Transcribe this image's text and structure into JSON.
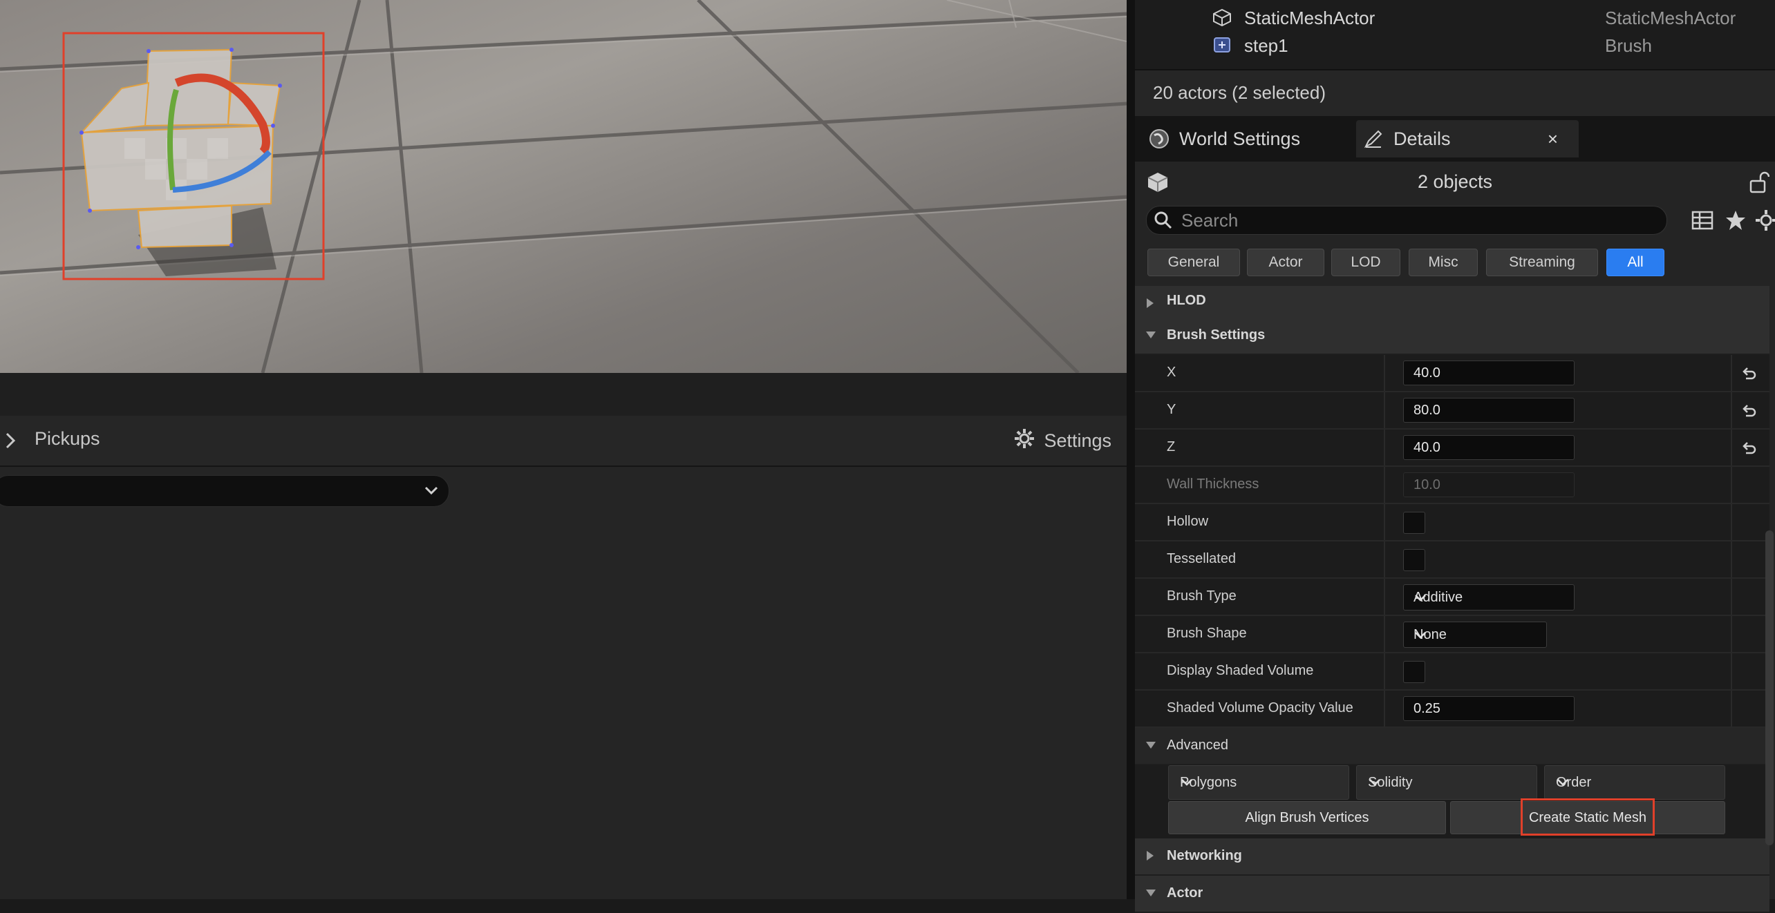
{
  "outliner": {
    "rows": [
      {
        "name": "StaticMeshActor",
        "type": "StaticMeshActor",
        "icon": "static-mesh-icon"
      },
      {
        "name": "step1",
        "type": "Brush",
        "icon": "brush-icon"
      }
    ],
    "status": "20 actors (2 selected)"
  },
  "tabs": {
    "world_settings": "World Settings",
    "details": "Details",
    "close": "×"
  },
  "details": {
    "objects": "2 objects",
    "search_placeholder": "Search",
    "filters": [
      "General",
      "Actor",
      "LOD",
      "Misc",
      "Streaming",
      "All"
    ],
    "active_filter": "All",
    "categories": {
      "hlod": "HLOD",
      "brush_settings": "Brush Settings",
      "advanced": "Advanced",
      "networking": "Networking",
      "actor": "Actor"
    },
    "props": {
      "x": {
        "label": "X",
        "value": "40.0"
      },
      "y": {
        "label": "Y",
        "value": "80.0"
      },
      "z": {
        "label": "Z",
        "value": "40.0"
      },
      "wall_thickness": {
        "label": "Wall Thickness",
        "value": "10.0"
      },
      "hollow": {
        "label": "Hollow",
        "checked": false
      },
      "tessellated": {
        "label": "Tessellated",
        "checked": false
      },
      "brush_type": {
        "label": "Brush Type",
        "value": "Additive"
      },
      "brush_shape": {
        "label": "Brush Shape",
        "value": "None"
      },
      "display_shaded_volume": {
        "label": "Display Shaded Volume",
        "checked": false
      },
      "shaded_volume_opacity": {
        "label": "Shaded Volume Opacity Value",
        "value": "0.25"
      }
    },
    "advanced": {
      "polygons": "Polygons",
      "solidity": "Solidity",
      "order": "Order",
      "align_button": "Align Brush Vertices",
      "create_button": "Create Static Mesh"
    }
  },
  "bottom_panel": {
    "title": "Pickups",
    "settings_label": "Settings"
  },
  "colors": {
    "accent": "#2a7df0",
    "highlight": "#e0402a",
    "panel_bg": "#242424"
  }
}
